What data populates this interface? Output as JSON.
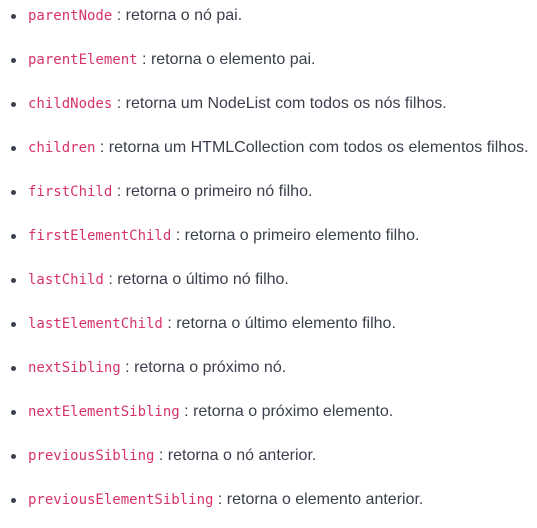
{
  "items": [
    {
      "code": "parentNode",
      "desc": "retorna o nó pai."
    },
    {
      "code": "parentElement",
      "desc": "retorna o elemento pai."
    },
    {
      "code": "childNodes",
      "desc": "retorna um NodeList com todos os nós filhos."
    },
    {
      "code": "children",
      "desc": "retorna um HTMLCollection com todos os elementos filhos."
    },
    {
      "code": "firstChild",
      "desc": "retorna o primeiro nó filho."
    },
    {
      "code": "firstElementChild",
      "desc": "retorna o primeiro elemento filho."
    },
    {
      "code": "lastChild",
      "desc": "retorna o último nó filho."
    },
    {
      "code": "lastElementChild",
      "desc": "retorna o último elemento filho."
    },
    {
      "code": "nextSibling",
      "desc": "retorna o próximo nó."
    },
    {
      "code": "nextElementSibling",
      "desc": "retorna o próximo elemento."
    },
    {
      "code": "previousSibling",
      "desc": "retorna o nó anterior."
    },
    {
      "code": "previousElementSibling",
      "desc": "retorna o elemento anterior."
    }
  ],
  "separator": ":"
}
